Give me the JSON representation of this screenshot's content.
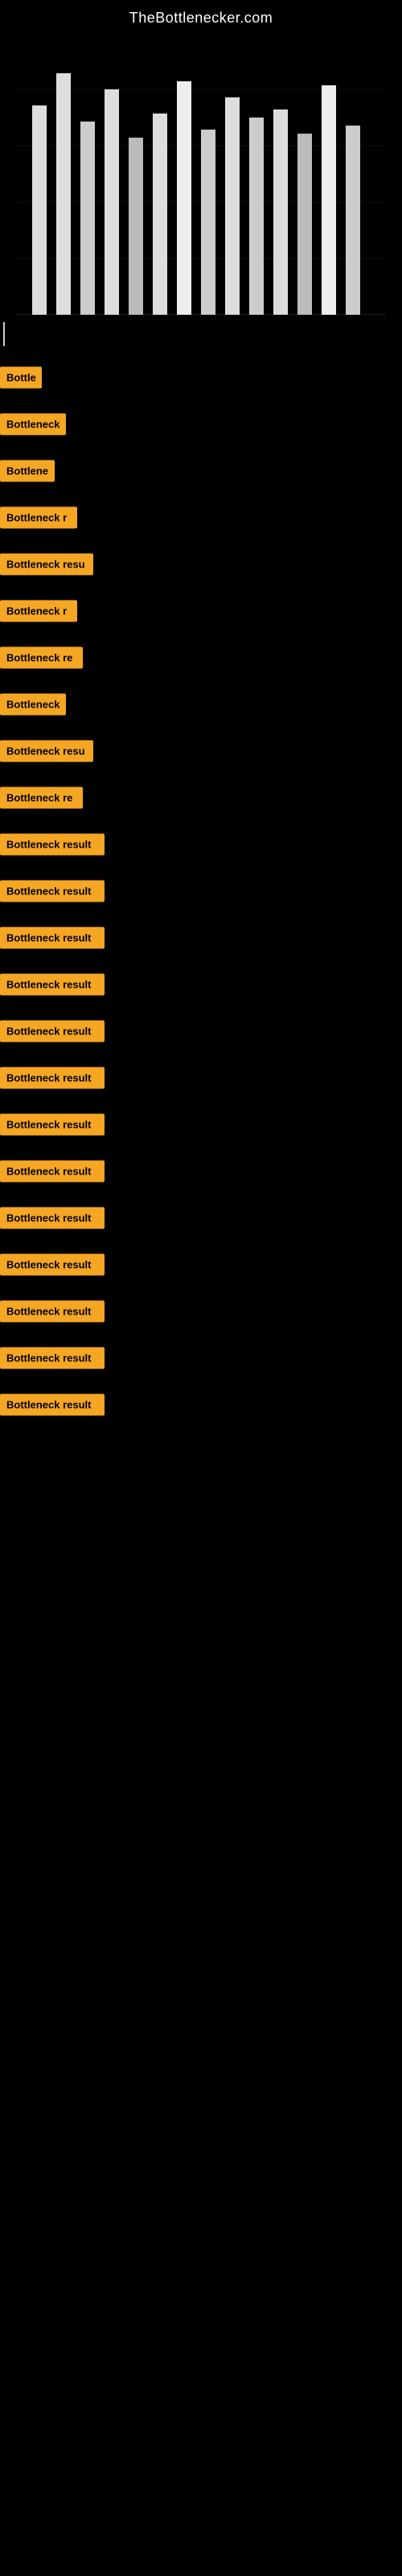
{
  "site": {
    "title": "TheBottlenecker.com"
  },
  "rows": [
    {
      "id": 1,
      "label": "Bottle",
      "width": 52
    },
    {
      "id": 2,
      "label": "Bottleneck",
      "width": 82
    },
    {
      "id": 3,
      "label": "Bottlene",
      "width": 68
    },
    {
      "id": 4,
      "label": "Bottleneck r",
      "width": 96
    },
    {
      "id": 5,
      "label": "Bottleneck resu",
      "width": 116
    },
    {
      "id": 6,
      "label": "Bottleneck r",
      "width": 96
    },
    {
      "id": 7,
      "label": "Bottleneck re",
      "width": 103
    },
    {
      "id": 8,
      "label": "Bottleneck",
      "width": 82
    },
    {
      "id": 9,
      "label": "Bottleneck resu",
      "width": 116
    },
    {
      "id": 10,
      "label": "Bottleneck re",
      "width": 103
    },
    {
      "id": 11,
      "label": "Bottleneck result",
      "width": 130
    },
    {
      "id": 12,
      "label": "Bottleneck result",
      "width": 130
    },
    {
      "id": 13,
      "label": "Bottleneck result",
      "width": 130
    },
    {
      "id": 14,
      "label": "Bottleneck result",
      "width": 130
    },
    {
      "id": 15,
      "label": "Bottleneck result",
      "width": 130
    },
    {
      "id": 16,
      "label": "Bottleneck result",
      "width": 130
    },
    {
      "id": 17,
      "label": "Bottleneck result",
      "width": 130
    },
    {
      "id": 18,
      "label": "Bottleneck result",
      "width": 130
    },
    {
      "id": 19,
      "label": "Bottleneck result",
      "width": 130
    },
    {
      "id": 20,
      "label": "Bottleneck result",
      "width": 130
    },
    {
      "id": 21,
      "label": "Bottleneck result",
      "width": 130
    },
    {
      "id": 22,
      "label": "Bottleneck result",
      "width": 130
    },
    {
      "id": 23,
      "label": "Bottleneck result",
      "width": 130
    }
  ],
  "accent_color": "#F5A623"
}
